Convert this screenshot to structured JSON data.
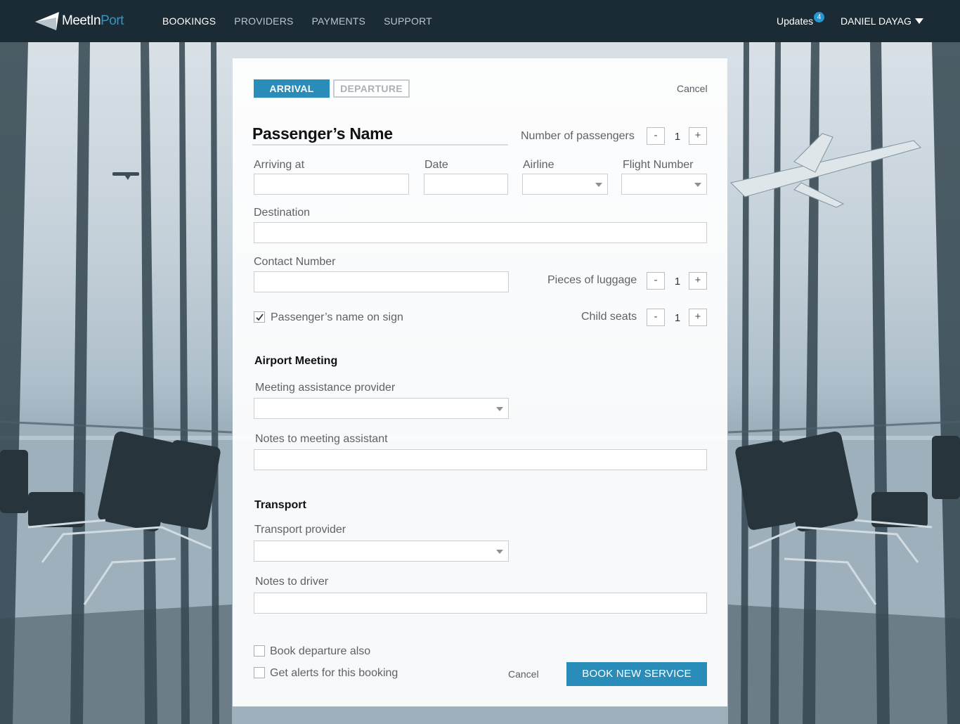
{
  "brand": {
    "name_part1": "MeetIn",
    "name_part2": "Port",
    "accent": "#2a8cb9"
  },
  "nav": {
    "items": [
      {
        "label": "BOOKINGS",
        "active": true
      },
      {
        "label": "PROVIDERS",
        "active": false
      },
      {
        "label": "PAYMENTS",
        "active": false
      },
      {
        "label": "SUPPORT",
        "active": false
      }
    ],
    "updates_label": "Updates",
    "updates_count": "4",
    "user_name": "DANIEL DAYAG"
  },
  "form": {
    "tabs": {
      "arrival": "ARRIVAL",
      "departure": "DEPARTURE"
    },
    "cancel_top": "Cancel",
    "passenger_name_placeholder": "Passenger’s Name",
    "passengers": {
      "label": "Number of passengers",
      "value": "1",
      "minus": "-",
      "plus": "+"
    },
    "arriving_at": {
      "label": "Arriving at",
      "value": ""
    },
    "date": {
      "label": "Date",
      "value": ""
    },
    "airline": {
      "label": "Airline",
      "value": ""
    },
    "flight_number": {
      "label": "Flight Number",
      "value": ""
    },
    "destination": {
      "label": "Destination",
      "value": ""
    },
    "contact_number": {
      "label": "Contact Number",
      "value": ""
    },
    "luggage": {
      "label": "Pieces of luggage",
      "value": "1",
      "minus": "-",
      "plus": "+"
    },
    "child_seats": {
      "label": "Child seats",
      "value": "1",
      "minus": "-",
      "plus": "+"
    },
    "name_on_sign": {
      "label": "Passenger’s name on sign",
      "checked": true
    },
    "airport_meeting": {
      "heading": "Airport Meeting",
      "provider_label": "Meeting assistance provider",
      "provider_value": "",
      "notes_label": "Notes to meeting assistant",
      "notes_value": ""
    },
    "transport": {
      "heading": "Transport",
      "provider_label": "Transport provider",
      "provider_value": "",
      "notes_label": "Notes to driver",
      "notes_value": ""
    },
    "book_departure": {
      "label": "Book departure also",
      "checked": false
    },
    "get_alerts": {
      "label": "Get alerts for this booking",
      "checked": false
    },
    "cancel_bottom": "Cancel",
    "submit": "BOOK NEW SERVICE"
  }
}
